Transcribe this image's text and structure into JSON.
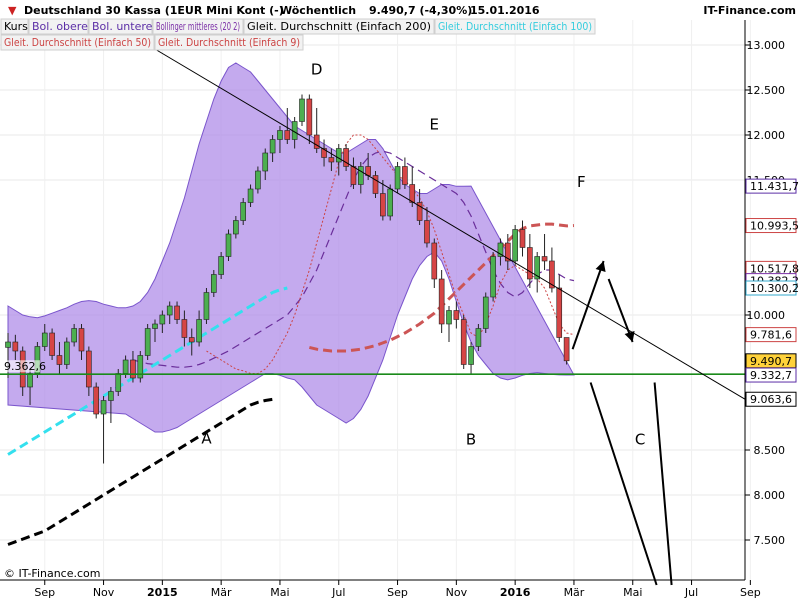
{
  "header": {
    "title": "Deutschland 30 Kassa (1EUR Mini Kont (-)",
    "period": "Wöchentlich",
    "quote": "9.490,7 (-4,30%)",
    "date": "15.01.2016",
    "brand": "IT-Finance.com"
  },
  "legend": [
    {
      "label": "Kurs",
      "color": "#000000"
    },
    {
      "label": "Bol. oberes",
      "color": "#5b2ea6"
    },
    {
      "label": "Bol. unteres",
      "color": "#5b2ea6"
    },
    {
      "label": "Bollinger mittleres (20 2)",
      "color": "#7a2ea6"
    },
    {
      "label": "Gleit. Durchschnitt (Einfach 200)",
      "color": "#000000"
    },
    {
      "label": "Gleit. Durchschnitt (Einfach 100)",
      "color": "#33ccdd"
    },
    {
      "label": "Gleit. Durchschnitt (Einfach 50)",
      "color": "#cc4444"
    },
    {
      "label": "Gleit. Durchschnitt (Einfach 9)",
      "color": "#cc4444"
    }
  ],
  "footer": {
    "copyright": "© IT-Finance.com"
  },
  "chart_data": {
    "type": "candlestick",
    "ylim": [
      7000,
      13300
    ],
    "x_ticks": [
      "Sep",
      "Nov",
      "2015",
      "Mär",
      "Mai",
      "Jul",
      "Sep",
      "Nov",
      "2016",
      "Mär",
      "Mai",
      "Jul",
      "Sep"
    ],
    "y_ticks": [
      "13.000",
      "12.500",
      "12.000",
      "11.500",
      "10.000",
      "8.500",
      "8.000",
      "7.500"
    ],
    "y_tick_values": [
      13000,
      12500,
      12000,
      11500,
      10000,
      8500,
      8000,
      7500
    ],
    "price_labels": [
      {
        "text": "11.431,7",
        "value": 11432,
        "color": "#5b2ea6"
      },
      {
        "text": "10.993,5",
        "value": 10994,
        "color": "#cc4444"
      },
      {
        "text": "10.517,8",
        "value": 10518,
        "color": "#cc4444"
      },
      {
        "text": "10.382,2",
        "value": 10382,
        "color": "#7a2ea6"
      },
      {
        "text": "10.300,2",
        "value": 10300,
        "color": "#33aacc"
      },
      {
        "text": "9.781,6",
        "value": 9782,
        "color": "#cc4444"
      },
      {
        "text": "9.490,7",
        "value": 9491,
        "color": "#000000"
      },
      {
        "text": "9.332,7",
        "value": 9333,
        "color": "#5b2ea6"
      },
      {
        "text": "9.063,6",
        "value": 9064,
        "color": "#000000"
      }
    ],
    "support_label": "9.362,6",
    "support_value": 9342,
    "wave_labels": [
      {
        "text": "A",
        "wk": 27,
        "value": 8570
      },
      {
        "text": "B",
        "wk": 63,
        "value": 8560
      },
      {
        "text": "C",
        "wk": 86,
        "value": 8560
      },
      {
        "text": "D",
        "wk": 42,
        "value": 12670
      },
      {
        "text": "E",
        "wk": 58,
        "value": 12060
      },
      {
        "text": "F",
        "wk": 78,
        "value": 11420
      }
    ],
    "candles": [
      [
        9640,
        9800,
        9300,
        9700
      ],
      [
        9700,
        9780,
        9500,
        9600
      ],
      [
        9600,
        9650,
        9100,
        9200
      ],
      [
        9200,
        9400,
        9000,
        9350
      ],
      [
        9350,
        9700,
        9300,
        9650
      ],
      [
        9650,
        9900,
        9600,
        9800
      ],
      [
        9800,
        9850,
        9500,
        9550
      ],
      [
        9550,
        9700,
        9350,
        9450
      ],
      [
        9450,
        9750,
        9400,
        9700
      ],
      [
        9700,
        9900,
        9650,
        9850
      ],
      [
        9850,
        9900,
        9500,
        9600
      ],
      [
        9600,
        9650,
        9100,
        9200
      ],
      [
        9200,
        9250,
        8850,
        8900
      ],
      [
        8900,
        9100,
        8350,
        9050
      ],
      [
        9050,
        9200,
        8800,
        9150
      ],
      [
        9150,
        9400,
        9100,
        9350
      ],
      [
        9350,
        9550,
        9300,
        9500
      ],
      [
        9500,
        9600,
        9250,
        9300
      ],
      [
        9300,
        9600,
        9250,
        9550
      ],
      [
        9550,
        9900,
        9500,
        9850
      ],
      [
        9850,
        9950,
        9700,
        9900
      ],
      [
        9900,
        10050,
        9800,
        10000
      ],
      [
        10000,
        10150,
        9900,
        10100
      ],
      [
        10100,
        10150,
        9900,
        9950
      ],
      [
        9950,
        10050,
        9650,
        9750
      ],
      [
        9750,
        9850,
        9550,
        9700
      ],
      [
        9700,
        10050,
        9650,
        9950
      ],
      [
        9950,
        10300,
        9900,
        10250
      ],
      [
        10250,
        10500,
        10200,
        10450
      ],
      [
        10450,
        10700,
        10400,
        10650
      ],
      [
        10650,
        10950,
        10600,
        10900
      ],
      [
        10900,
        11100,
        10850,
        11050
      ],
      [
        11050,
        11300,
        11000,
        11250
      ],
      [
        11250,
        11450,
        11200,
        11400
      ],
      [
        11400,
        11650,
        11350,
        11600
      ],
      [
        11600,
        11850,
        11500,
        11800
      ],
      [
        11800,
        12000,
        11700,
        11950
      ],
      [
        11950,
        12100,
        11800,
        12050
      ],
      [
        12050,
        12300,
        11900,
        11950
      ],
      [
        11950,
        12200,
        11850,
        12150
      ],
      [
        12150,
        12450,
        12100,
        12400
      ],
      [
        12400,
        12450,
        11900,
        12000
      ],
      [
        12000,
        12300,
        11800,
        11850
      ],
      [
        11850,
        11950,
        11650,
        11750
      ],
      [
        11750,
        11850,
        11600,
        11700
      ],
      [
        11700,
        11900,
        11550,
        11850
      ],
      [
        11850,
        11900,
        11600,
        11650
      ],
      [
        11650,
        11750,
        11400,
        11450
      ],
      [
        11450,
        11700,
        11350,
        11650
      ],
      [
        11650,
        11800,
        11500,
        11550
      ],
      [
        11550,
        11600,
        11300,
        11350
      ],
      [
        11350,
        11500,
        11050,
        11100
      ],
      [
        11100,
        11450,
        11050,
        11400
      ],
      [
        11400,
        11700,
        11350,
        11650
      ],
      [
        11650,
        11750,
        11400,
        11450
      ],
      [
        11450,
        11650,
        11200,
        11250
      ],
      [
        11250,
        11400,
        11000,
        11050
      ],
      [
        11050,
        11200,
        10750,
        10800
      ],
      [
        10800,
        10850,
        10300,
        10400
      ],
      [
        10400,
        10500,
        9800,
        9900
      ],
      [
        9900,
        10100,
        9700,
        10050
      ],
      [
        10050,
        10150,
        9850,
        9950
      ],
      [
        9950,
        10000,
        9400,
        9450
      ],
      [
        9450,
        9700,
        9350,
        9650
      ],
      [
        9650,
        9900,
        9600,
        9850
      ],
      [
        9850,
        10250,
        9800,
        10200
      ],
      [
        10200,
        10700,
        10150,
        10650
      ],
      [
        10650,
        10850,
        10550,
        10800
      ],
      [
        10800,
        10900,
        10500,
        10600
      ],
      [
        10600,
        11000,
        10550,
        10950
      ],
      [
        10950,
        11050,
        10650,
        10750
      ],
      [
        10750,
        10900,
        10300,
        10400
      ],
      [
        10400,
        10700,
        10250,
        10650
      ],
      [
        10650,
        10900,
        10500,
        10600
      ],
      [
        10600,
        10750,
        10250,
        10300
      ],
      [
        10300,
        10450,
        9700,
        9750
      ],
      [
        9750,
        9700,
        9450,
        9491
      ]
    ],
    "series": [
      {
        "name": "Bol. oberes",
        "values": [
          10100,
          10050,
          10000,
          9980,
          9970,
          9990,
          10020,
          10050,
          10080,
          10120,
          10150,
          10160,
          10150,
          10120,
          10100,
          10080,
          10080,
          10100,
          10150,
          10250,
          10400,
          10600,
          10800,
          11050,
          11300,
          11600,
          11900,
          12150,
          12400,
          12600,
          12750,
          12800,
          12750,
          12700,
          12600,
          12500,
          12400,
          12300,
          12200,
          12100,
          12050,
          12000,
          11950,
          11900,
          11850,
          11800,
          11800,
          11850,
          11900,
          11950,
          11950,
          11850,
          11700,
          11550,
          11450,
          11400,
          11350,
          11350,
          11400,
          11450,
          11450,
          11430,
          11430,
          11432
        ]
      },
      {
        "name": "Bol. unteres",
        "values": [
          8900,
          8850,
          8800,
          8750,
          8700,
          8700,
          8720,
          8750,
          8800,
          8850,
          8900,
          8950,
          9000,
          9050,
          9100,
          9150,
          9200,
          9250,
          9300,
          9350,
          9350,
          9330,
          9300,
          9280,
          9200,
          9100,
          9000,
          8950,
          8900,
          8850,
          8800,
          8850,
          8950,
          9100,
          9300,
          9500,
          9750,
          10000,
          10200,
          10400,
          10550,
          10650,
          10700,
          10600,
          10400,
          10150,
          9900,
          9700,
          9550,
          9450,
          9350,
          9300,
          9280,
          9300,
          9330,
          9350,
          9360,
          9350,
          9340,
          9335,
          9333,
          9333
        ]
      },
      {
        "name": "Bollinger mittleres (20 2)",
        "values": [
          9500,
          9480,
          9460,
          9450,
          9440,
          9430,
          9420,
          9420,
          9430,
          9450,
          9480,
          9520,
          9560,
          9600,
          9650,
          9700,
          9750,
          9800,
          9850,
          9900,
          9950,
          10000,
          10100,
          10200,
          10350,
          10500,
          10700,
          10900,
          11100,
          11300,
          11500,
          11650,
          11750,
          11800,
          11820,
          11800,
          11750,
          11700,
          11650,
          11600,
          11550,
          11500,
          11450,
          11400,
          11350,
          11250,
          11100,
          10900,
          10700,
          10500,
          10350,
          10250,
          10200,
          10250,
          10350,
          10450,
          10500,
          10500,
          10450,
          10400,
          10382
        ]
      },
      {
        "name": "Gleit. Durchschnitt (Einfach 200)",
        "values": [
          7450,
          7480,
          7510,
          7540,
          7570,
          7600,
          7650,
          7700,
          7750,
          7800,
          7850,
          7900,
          7950,
          8000,
          8050,
          8100,
          8150,
          8200,
          8250,
          8300,
          8350,
          8400,
          8450,
          8500,
          8550,
          8600,
          8650,
          8700,
          8750,
          8800,
          8850,
          8900,
          8950,
          9000,
          9030,
          9050,
          9063
        ]
      },
      {
        "name": "Gleit. Durchschnitt (Einfach 100)",
        "values": [
          8450,
          8500,
          8550,
          8600,
          8650,
          8700,
          8750,
          8800,
          8850,
          8900,
          8950,
          9000,
          9050,
          9100,
          9150,
          9200,
          9250,
          9300,
          9350,
          9400,
          9450,
          9500,
          9550,
          9600,
          9650,
          9700,
          9750,
          9800,
          9850,
          9900,
          9950,
          10000,
          10050,
          10100,
          10150,
          10200,
          10250,
          10280,
          10300
        ]
      },
      {
        "name": "Gleit. Durchschnitt (Einfach 50)",
        "values": [
          9640,
          9620,
          9610,
          9600,
          9600,
          9600,
          9610,
          9620,
          9640,
          9660,
          9690,
          9720,
          9760,
          9800,
          9850,
          9900,
          9960,
          10020,
          10100,
          10180,
          10260,
          10340,
          10420,
          10500,
          10580,
          10660,
          10740,
          10820,
          10900,
          10960,
          10990,
          11000,
          11010,
          11010,
          11000,
          10990,
          10994
        ]
      },
      {
        "name": "Gleit. Durchschnitt (Einfach 9)",
        "values": [
          9600,
          9550,
          9500,
          9450,
          9400,
          9380,
          9350,
          9350,
          9400,
          9500,
          9650,
          9800,
          10000,
          10250,
          10500,
          10800,
          11100,
          11400,
          11700,
          11900,
          12000,
          12000,
          11950,
          11850,
          11750,
          11650,
          11550,
          11500,
          11400,
          11300,
          11150,
          10950,
          10700,
          10450,
          10200,
          10000,
          9800,
          9750,
          9900,
          10100,
          10350,
          10500,
          10550,
          10500,
          10450,
          10400,
          10300,
          10100,
          9900,
          9800,
          9782
        ]
      }
    ],
    "support_level": 9342,
    "trendline": {
      "from_value": 13100,
      "to_value": 9064
    },
    "projection": {
      "peak": 10600,
      "low": 9700,
      "bottom": 7000
    }
  }
}
